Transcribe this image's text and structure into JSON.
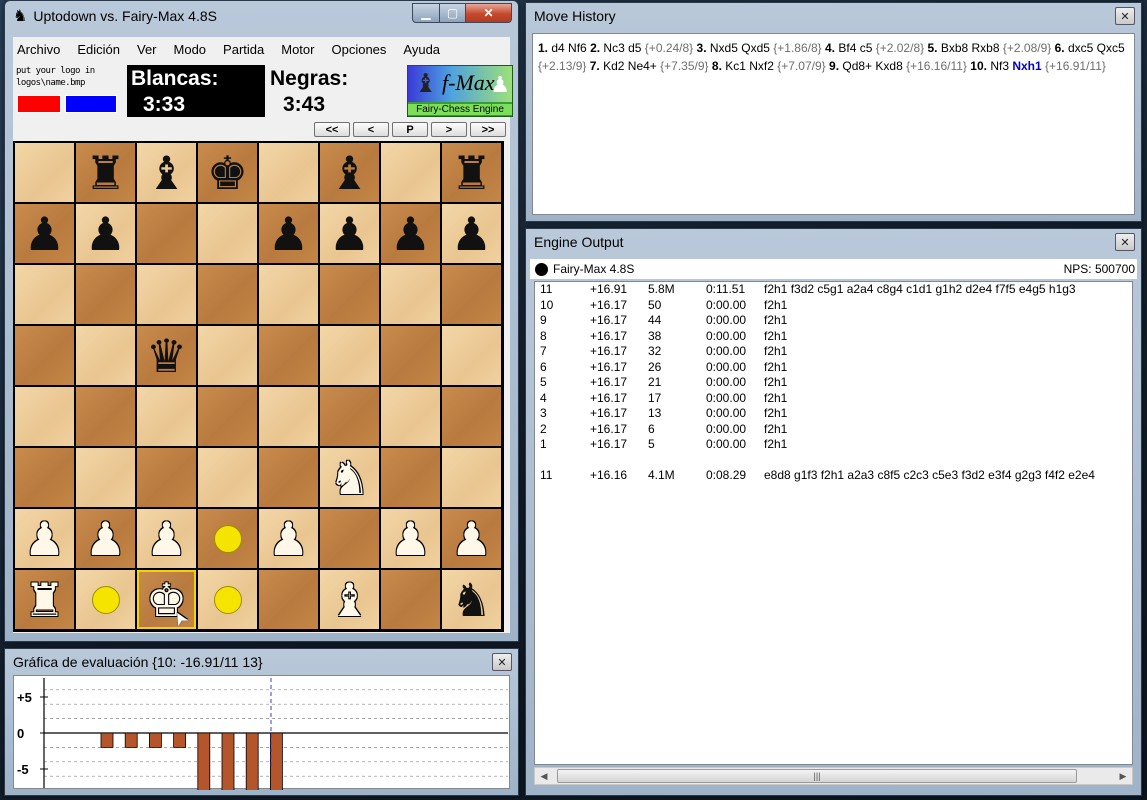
{
  "main_window": {
    "title": "Uptodown vs. Fairy-Max 4.8S",
    "menu": [
      "Archivo",
      "Edición",
      "Ver",
      "Modo",
      "Partida",
      "Motor",
      "Opciones",
      "Ayuda"
    ],
    "logo_placeholder": [
      "put your logo in",
      "logos\\name.bmp"
    ],
    "white_flag_color": "#ff0000",
    "black_flag_color": "#0000ff",
    "white_clock": {
      "label": "Blancas:",
      "time": "3:33"
    },
    "black_clock": {
      "label": "Negras:",
      "time": "3:43"
    },
    "engine_logo": {
      "name": "f-Max",
      "subtitle": "Fairy-Chess Engine"
    },
    "nav_buttons": [
      "<<",
      "<",
      "P",
      ">",
      ">>"
    ]
  },
  "board": {
    "rows": [
      [
        "",
        "bR",
        "bB",
        "bK",
        "",
        "bB",
        "",
        "bR"
      ],
      [
        "bP",
        "bP",
        "",
        "",
        "bP",
        "bP",
        "bP",
        "bP"
      ],
      [
        "",
        "",
        "",
        "",
        "",
        "",
        "",
        ""
      ],
      [
        "",
        "",
        "bQ",
        "",
        "",
        "",
        "",
        ""
      ],
      [
        "",
        "",
        "",
        "",
        "",
        "",
        "",
        ""
      ],
      [
        "",
        "",
        "",
        "",
        "",
        "wN",
        "",
        ""
      ],
      [
        "wP",
        "wP",
        "wP",
        "dot",
        "wP",
        "",
        "wP",
        "wP"
      ],
      [
        "wR",
        "dot",
        "wK",
        "dot",
        "",
        "wB",
        "",
        "bN"
      ]
    ],
    "highlight_square": "c1"
  },
  "move_history": {
    "title": "Move History",
    "moves": [
      {
        "n": "1.",
        "m": "d4 Nf6",
        "w": "2.",
        "m2": "Nc3 d5",
        "e": "{+0.24/8}"
      },
      {
        "n": "3.",
        "m": "Nxd5 Qxd5",
        "e": "{+1.86/8}"
      },
      {
        "n": "4.",
        "m": "Bf4 c5",
        "e": "{+2.02/8}"
      },
      {
        "n": "5.",
        "m": "Bxb8 Rxb8",
        "e": "{+2.08/9}"
      },
      {
        "n": "6.",
        "m": "dxc5 Qxc5",
        "e": "{+2.13/9}"
      },
      {
        "n": "7.",
        "m": "Kd2 Ne4+",
        "e": "{+7.35/9}"
      },
      {
        "n": "8.",
        "m": "Kc1 Nxf2",
        "e": "{+7.07/9}"
      },
      {
        "n": "9.",
        "m": "Qd8+ Kxd8",
        "e": "{+16.16/11}"
      },
      {
        "n": "10.",
        "m": "Nf3",
        "cur": "Nxh1",
        "e": "{+16.91/11}"
      }
    ]
  },
  "engine_output": {
    "title": "Engine Output",
    "engine_name": "Fairy-Max 4.8S",
    "nps": "NPS: 500700",
    "lines": [
      {
        "d": "11",
        "s": "+16.91",
        "n": "5.8M",
        "t": "0:11.51",
        "pv": "f2h1 f3d2 c5g1 a2a4 c8g4 c1d1 g1h2 d2e4 f7f5 e4g5 h1g3"
      },
      {
        "d": "10",
        "s": "+16.17",
        "n": "50",
        "t": "0:00.00",
        "pv": "f2h1"
      },
      {
        "d": "9",
        "s": "+16.17",
        "n": "44",
        "t": "0:00.00",
        "pv": "f2h1"
      },
      {
        "d": "8",
        "s": "+16.17",
        "n": "38",
        "t": "0:00.00",
        "pv": "f2h1"
      },
      {
        "d": "7",
        "s": "+16.17",
        "n": "32",
        "t": "0:00.00",
        "pv": "f2h1"
      },
      {
        "d": "6",
        "s": "+16.17",
        "n": "26",
        "t": "0:00.00",
        "pv": "f2h1"
      },
      {
        "d": "5",
        "s": "+16.17",
        "n": "21",
        "t": "0:00.00",
        "pv": "f2h1"
      },
      {
        "d": "4",
        "s": "+16.17",
        "n": "17",
        "t": "0:00.00",
        "pv": "f2h1"
      },
      {
        "d": "3",
        "s": "+16.17",
        "n": "13",
        "t": "0:00.00",
        "pv": "f2h1"
      },
      {
        "d": "2",
        "s": "+16.17",
        "n": "6",
        "t": "0:00.00",
        "pv": "f2h1"
      },
      {
        "d": "1",
        "s": "+16.17",
        "n": "5",
        "t": "0:00.00",
        "pv": "f2h1"
      },
      {
        "d": "",
        "s": "",
        "n": "",
        "t": "",
        "pv": ""
      },
      {
        "d": "11",
        "s": "+16.16",
        "n": "4.1M",
        "t": "0:08.29",
        "pv": "e8d8 g1f3 f2h1 a2a3 c8f5 c2c3 c5e3 f3d2 e3f4 g2g3 f4f2 e2e4"
      }
    ]
  },
  "eval_graph": {
    "title": "Gráfica de evaluación {10:  -16.91/11 13}",
    "y_labels": [
      "+5",
      "0",
      "-5"
    ],
    "bar_color": "#b5552b",
    "marker_color": "#3b3bd0",
    "bars": [
      -1,
      -1,
      -1,
      -1,
      -4,
      -4,
      -4,
      -4
    ]
  }
}
